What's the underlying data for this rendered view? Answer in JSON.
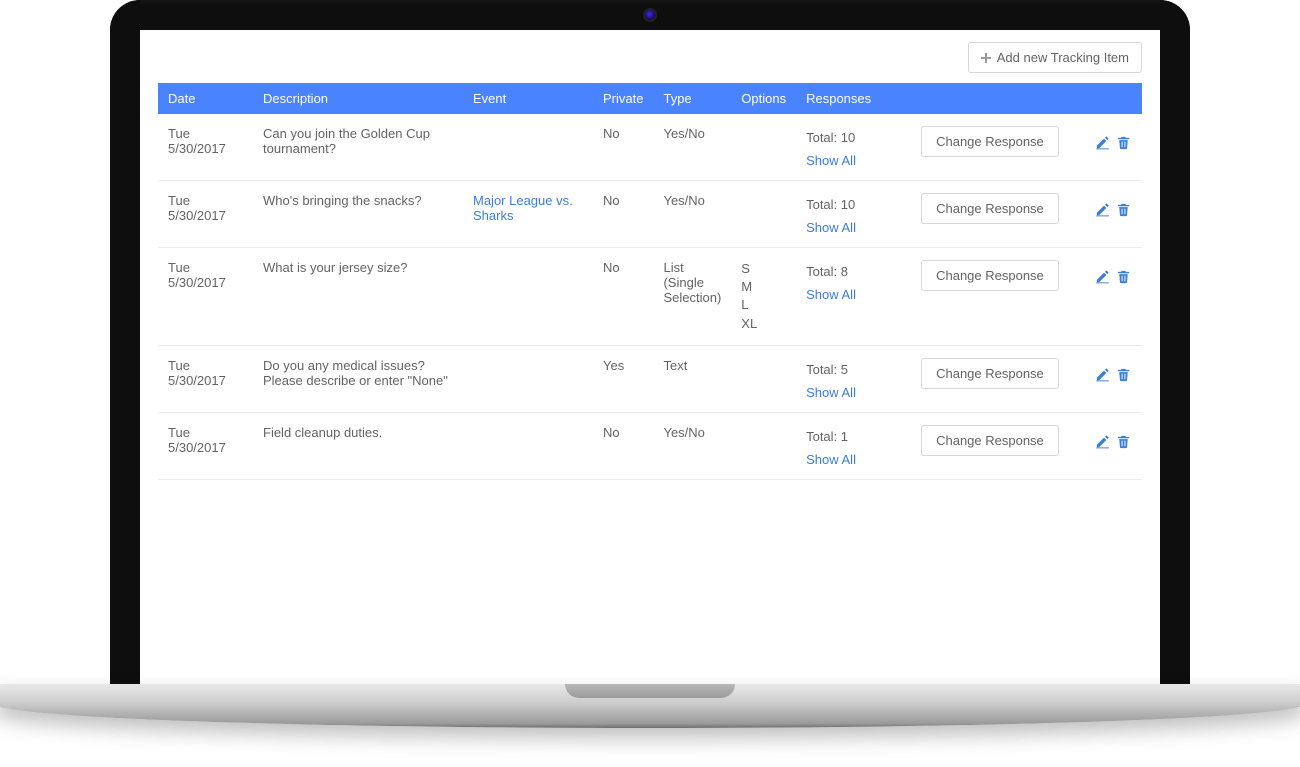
{
  "toolbar": {
    "add_button_label": "Add new Tracking Item"
  },
  "table": {
    "headers": {
      "date": "Date",
      "description": "Description",
      "event": "Event",
      "private": "Private",
      "type": "Type",
      "options": "Options",
      "responses": "Responses"
    },
    "change_response_label": "Change Response",
    "show_all_label": "Show All",
    "rows": [
      {
        "date": "Tue 5/30/2017",
        "description": "Can you join the Golden Cup tournament?",
        "event": "",
        "private": "No",
        "type": "Yes/No",
        "options": "",
        "responses_total": "Total: 10"
      },
      {
        "date": "Tue 5/30/2017",
        "description": "Who's bringing the snacks?",
        "event": "Major League vs. Sharks",
        "private": "No",
        "type": "Yes/No",
        "options": "",
        "responses_total": "Total: 10"
      },
      {
        "date": "Tue 5/30/2017",
        "description": "What is your jersey size?",
        "event": "",
        "private": "No",
        "type": "List (Single Selection)",
        "options": "S\nM\nL\nXL",
        "responses_total": "Total: 8"
      },
      {
        "date": "Tue 5/30/2017",
        "description": "Do you any medical issues? Please describe or enter \"None\"",
        "event": "",
        "private": "Yes",
        "type": "Text",
        "options": "",
        "responses_total": "Total: 5"
      },
      {
        "date": "Tue 5/30/2017",
        "description": "Field cleanup duties.",
        "event": "",
        "private": "No",
        "type": "Yes/No",
        "options": "",
        "responses_total": "Total: 1"
      }
    ]
  }
}
